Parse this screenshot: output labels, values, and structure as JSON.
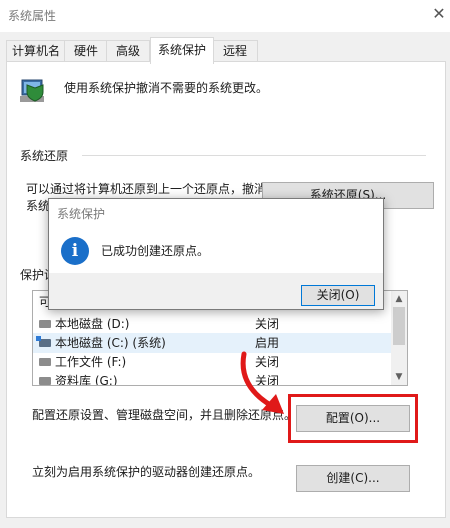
{
  "window": {
    "title": "系统属性",
    "close_glyph": "✕"
  },
  "tabs": [
    {
      "label": "计算机名"
    },
    {
      "label": "硬件"
    },
    {
      "label": "高级"
    },
    {
      "label": "系统保护"
    },
    {
      "label": "远程"
    }
  ],
  "active_tab": "系统保护",
  "intro": "使用系统保护撤消不需要的系统更改。",
  "restore": {
    "section_title": "系统还原",
    "desc_line1": "可以通过将计算机还原到上一个还原点，撤消",
    "desc_line2": "系统",
    "button_label": "系统还原(S)..."
  },
  "protection": {
    "section_title": "保护设",
    "list_header": "可",
    "drives": [
      {
        "name": "本地磁盘 (D:)",
        "status": "关闭"
      },
      {
        "name": "本地磁盘 (C:) (系统)",
        "status": "启用"
      },
      {
        "name": "工作文件 (F:)",
        "status": "关闭"
      },
      {
        "name": "资料库 (G:)",
        "status": "关闭"
      }
    ]
  },
  "configure": {
    "desc": "配置还原设置、管理磁盘空间，并且删除还原点。",
    "button_label": "配置(O)..."
  },
  "create": {
    "desc": "立刻为启用系统保护的驱动器创建还原点。",
    "button_label": "创建(C)..."
  },
  "dialog": {
    "title": "系统保护",
    "icon_glyph": "i",
    "message": "已成功创建还原点。",
    "close_label": "关闭(O)"
  },
  "colors": {
    "highlight": "#e01919",
    "info_blue": "#1a6fc9",
    "focus_border": "#0078d7"
  },
  "icons": [
    "shield-computer-icon",
    "drive-icon",
    "system-drive-icon",
    "info-icon",
    "red-arrow-annotation"
  ]
}
